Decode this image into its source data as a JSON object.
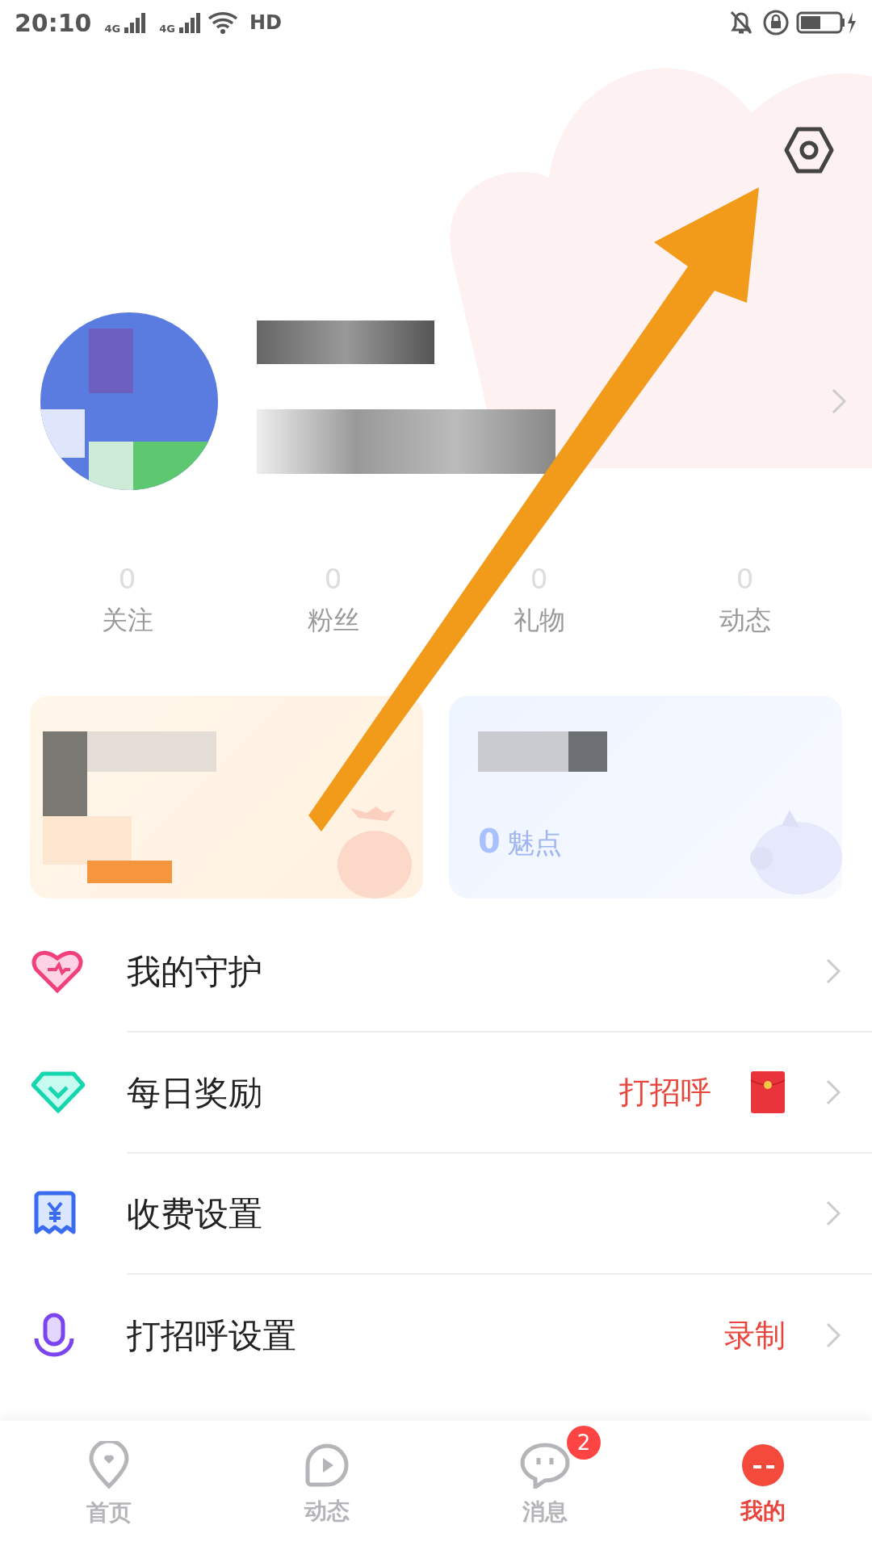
{
  "status_bar": {
    "time": "20:10",
    "network": [
      "4G",
      "4G"
    ],
    "hd_label": "HD"
  },
  "stats": [
    {
      "count": "0",
      "label": "关注"
    },
    {
      "count": "0",
      "label": "粉丝"
    },
    {
      "count": "0",
      "label": "礼物"
    },
    {
      "count": "0",
      "label": "动态"
    }
  ],
  "cards": [
    {
      "kind": "recharge"
    },
    {
      "kind": "earnings",
      "amount": "0",
      "unit": "魅点"
    }
  ],
  "menu": [
    {
      "kind": "heart",
      "label": "我的守护"
    },
    {
      "kind": "diamond",
      "label": "每日奖励",
      "action": "打招呼",
      "gift": true
    },
    {
      "kind": "yen",
      "label": "收费设置"
    },
    {
      "kind": "mic",
      "label": "打招呼设置",
      "action": "录制"
    }
  ],
  "nav": [
    {
      "kind": "pin",
      "label": "首页",
      "selected": false
    },
    {
      "kind": "play",
      "label": "动态",
      "selected": false
    },
    {
      "kind": "chat",
      "label": "消息",
      "badge": "2",
      "selected": false
    },
    {
      "kind": "face",
      "label": "我的",
      "selected": true
    }
  ]
}
